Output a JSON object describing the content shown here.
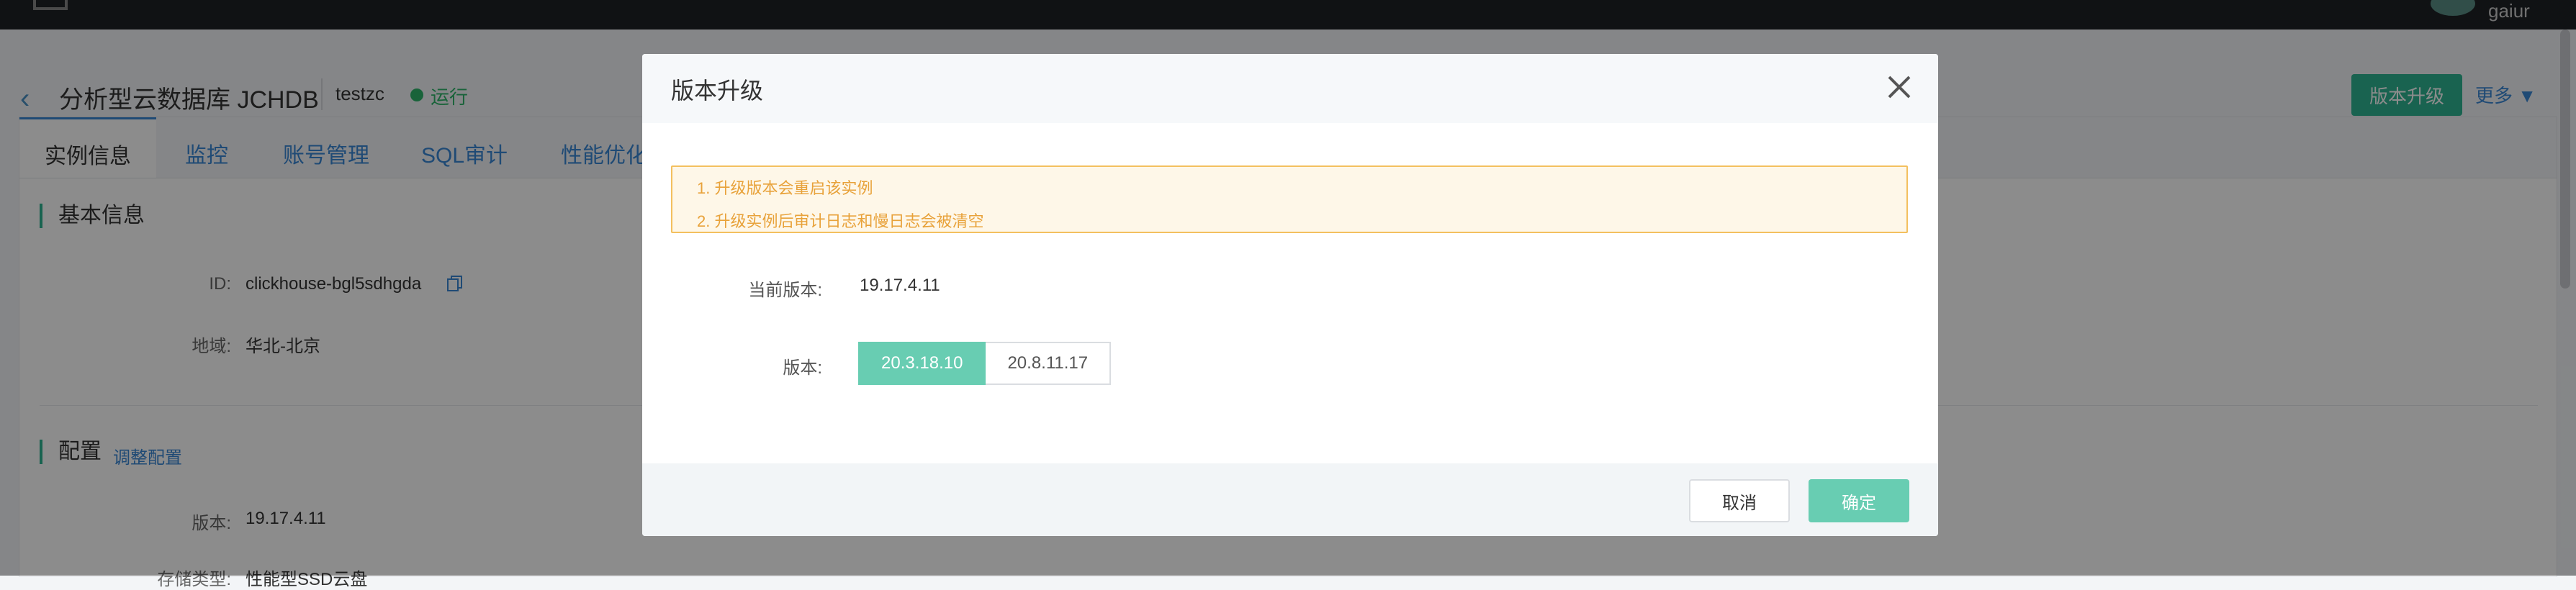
{
  "topbar": {
    "user": "gaiur"
  },
  "header": {
    "title": "分析型云数据库 JCHDB",
    "instance_name": "testzc",
    "status": "运行",
    "upgrade_button": "版本升级",
    "more_button": "更多"
  },
  "tabs": [
    {
      "label": "实例信息",
      "active": true
    },
    {
      "label": "监控"
    },
    {
      "label": "账号管理"
    },
    {
      "label": "SQL审计"
    },
    {
      "label": "性能优化"
    }
  ],
  "basic_info": {
    "title": "基本信息",
    "id_label": "ID:",
    "id_value": "clickhouse-bgl5sdhgda",
    "region_label": "地域:",
    "region_value": "华北-北京"
  },
  "config": {
    "title": "配置",
    "adjust_link": "调整配置",
    "version_label": "版本:",
    "version_value": "19.17.4.11",
    "storage_label": "存储类型:",
    "storage_value": "性能型SSD云盘"
  },
  "modal": {
    "title": "版本升级",
    "notice": [
      "1. 升级版本会重启该实例",
      "2. 升级实例后审计日志和慢日志会被清空"
    ],
    "current_version_label": "当前版本:",
    "current_version_value": "19.17.4.11",
    "version_label": "版本:",
    "version_options": [
      "20.3.18.10",
      "20.8.11.17"
    ],
    "selected_version": "20.3.18.10",
    "cancel": "取消",
    "confirm": "确定"
  },
  "colors": {
    "accent_green": "#2fb492",
    "modal_green": "#68cdb2",
    "link_blue": "#3a88d6",
    "notice_border": "#f3c05f",
    "notice_text": "#e8a23a"
  }
}
